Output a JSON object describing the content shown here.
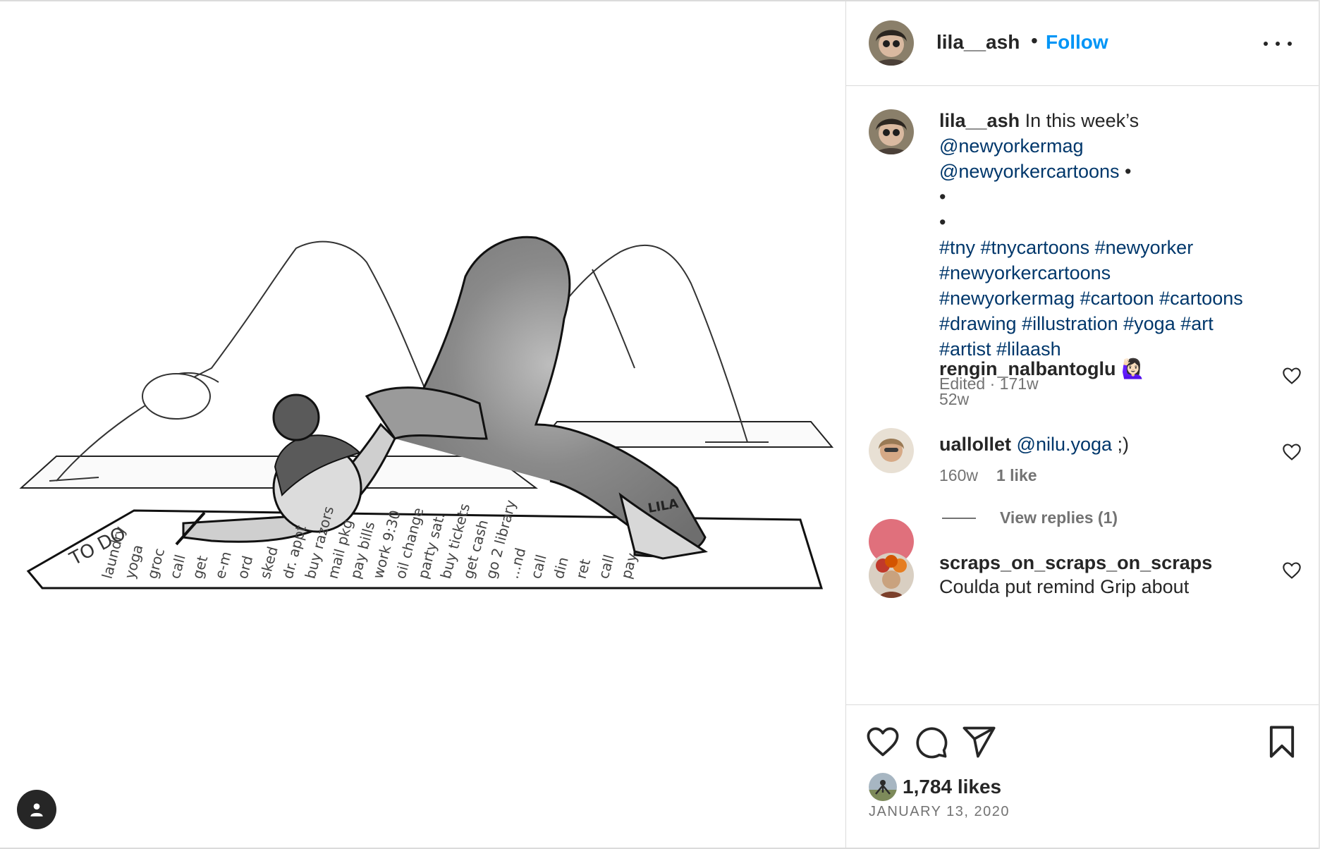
{
  "post": {
    "username": "lila__ash",
    "dot": "•",
    "follow_label": "Follow"
  },
  "caption": {
    "username": "lila__ash",
    "text": " In this week’s",
    "mention1": "@newyorkermag",
    "mention2": "@newyorkercartoons",
    "bullet": " •",
    "dot_line1": "•",
    "dot_line2": "•",
    "hashtags_line1": "#tny #tnycartoons #newyorker",
    "hashtags_line2": "#newyorkercartoons",
    "hashtags_line3": "#newyorkermag #cartoon #cartoons",
    "hashtags_line4": "#drawing #illustration #yoga #art",
    "hashtags_line5": "#artist #lilaash",
    "meta": "Edited · 171w"
  },
  "comments": [
    {
      "username": "rengin_nalbantoglu",
      "text": " 🙋🏻‍♀️",
      "time": "52w",
      "likes": ""
    },
    {
      "username": "uallollet",
      "mention": "@nilu.yoga",
      "text": " ;)",
      "time": "160w",
      "likes": "1 like"
    },
    {
      "username": "scraps_on_scraps_on_scraps",
      "text": "Coulda put remind Grip about"
    }
  ],
  "view_replies": "View replies (1)",
  "artwork": {
    "signature": "LILA",
    "todo_title": "TO DO",
    "todo_items": [
      "laundry",
      "yoga",
      "groc",
      "call",
      "get",
      "e-m",
      "ord",
      "sked",
      "dr. appt",
      "buy razors",
      "mail pkg",
      "pay bills",
      "work 9:30",
      "oil change",
      "party sat.",
      "buy tickets",
      "get cash",
      "go 2 library",
      "...nd",
      "call",
      "din",
      "ret",
      "call",
      "pay"
    ]
  },
  "likes_count": "1,784 likes",
  "date": "JANUARY 13, 2020",
  "icons": {
    "more": "more-options-icon",
    "heart": "heart-icon",
    "comment": "comment-icon",
    "share": "share-icon",
    "save": "bookmark-icon",
    "user_tag": "user-tag-icon"
  },
  "colors": {
    "link": "#00376b",
    "follow": "#0095f6",
    "muted": "#737373",
    "text": "#262626"
  }
}
